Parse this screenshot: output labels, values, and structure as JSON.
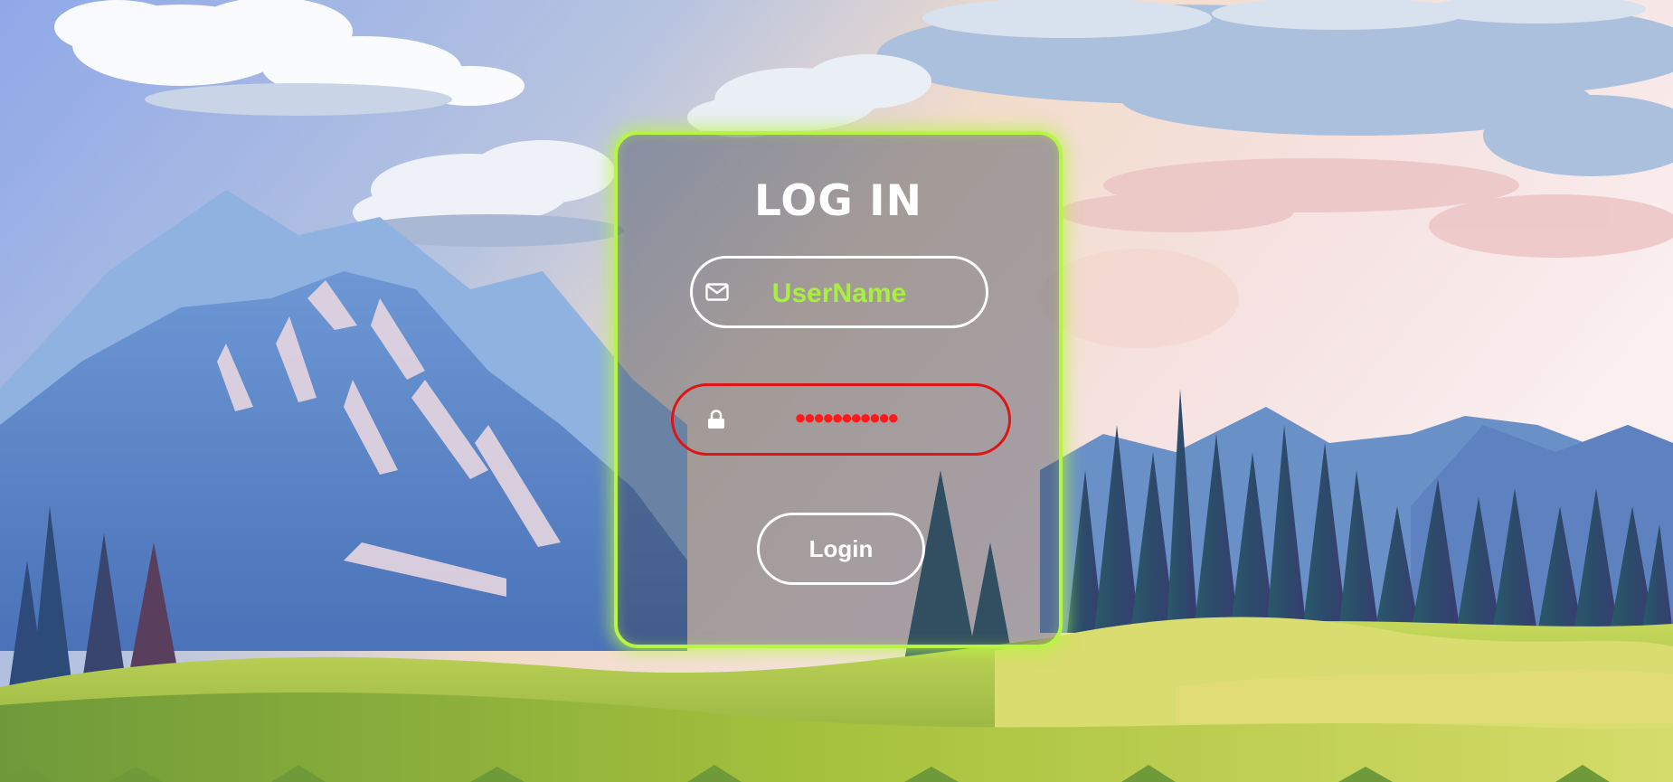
{
  "login": {
    "title": "LOG IN",
    "username": {
      "placeholder": "UserName",
      "icon": "envelope-icon",
      "border_color": "#ffffff",
      "text_color": "#a8f03e"
    },
    "password": {
      "value": "●●●●●●●●●●●",
      "icon": "lock-icon",
      "border_color": "#e01414",
      "text_color": "#ff1a1a"
    },
    "submit_label": "Login"
  },
  "theme": {
    "card_glow": "#b7f542",
    "background": "mountain-landscape-illustration"
  }
}
